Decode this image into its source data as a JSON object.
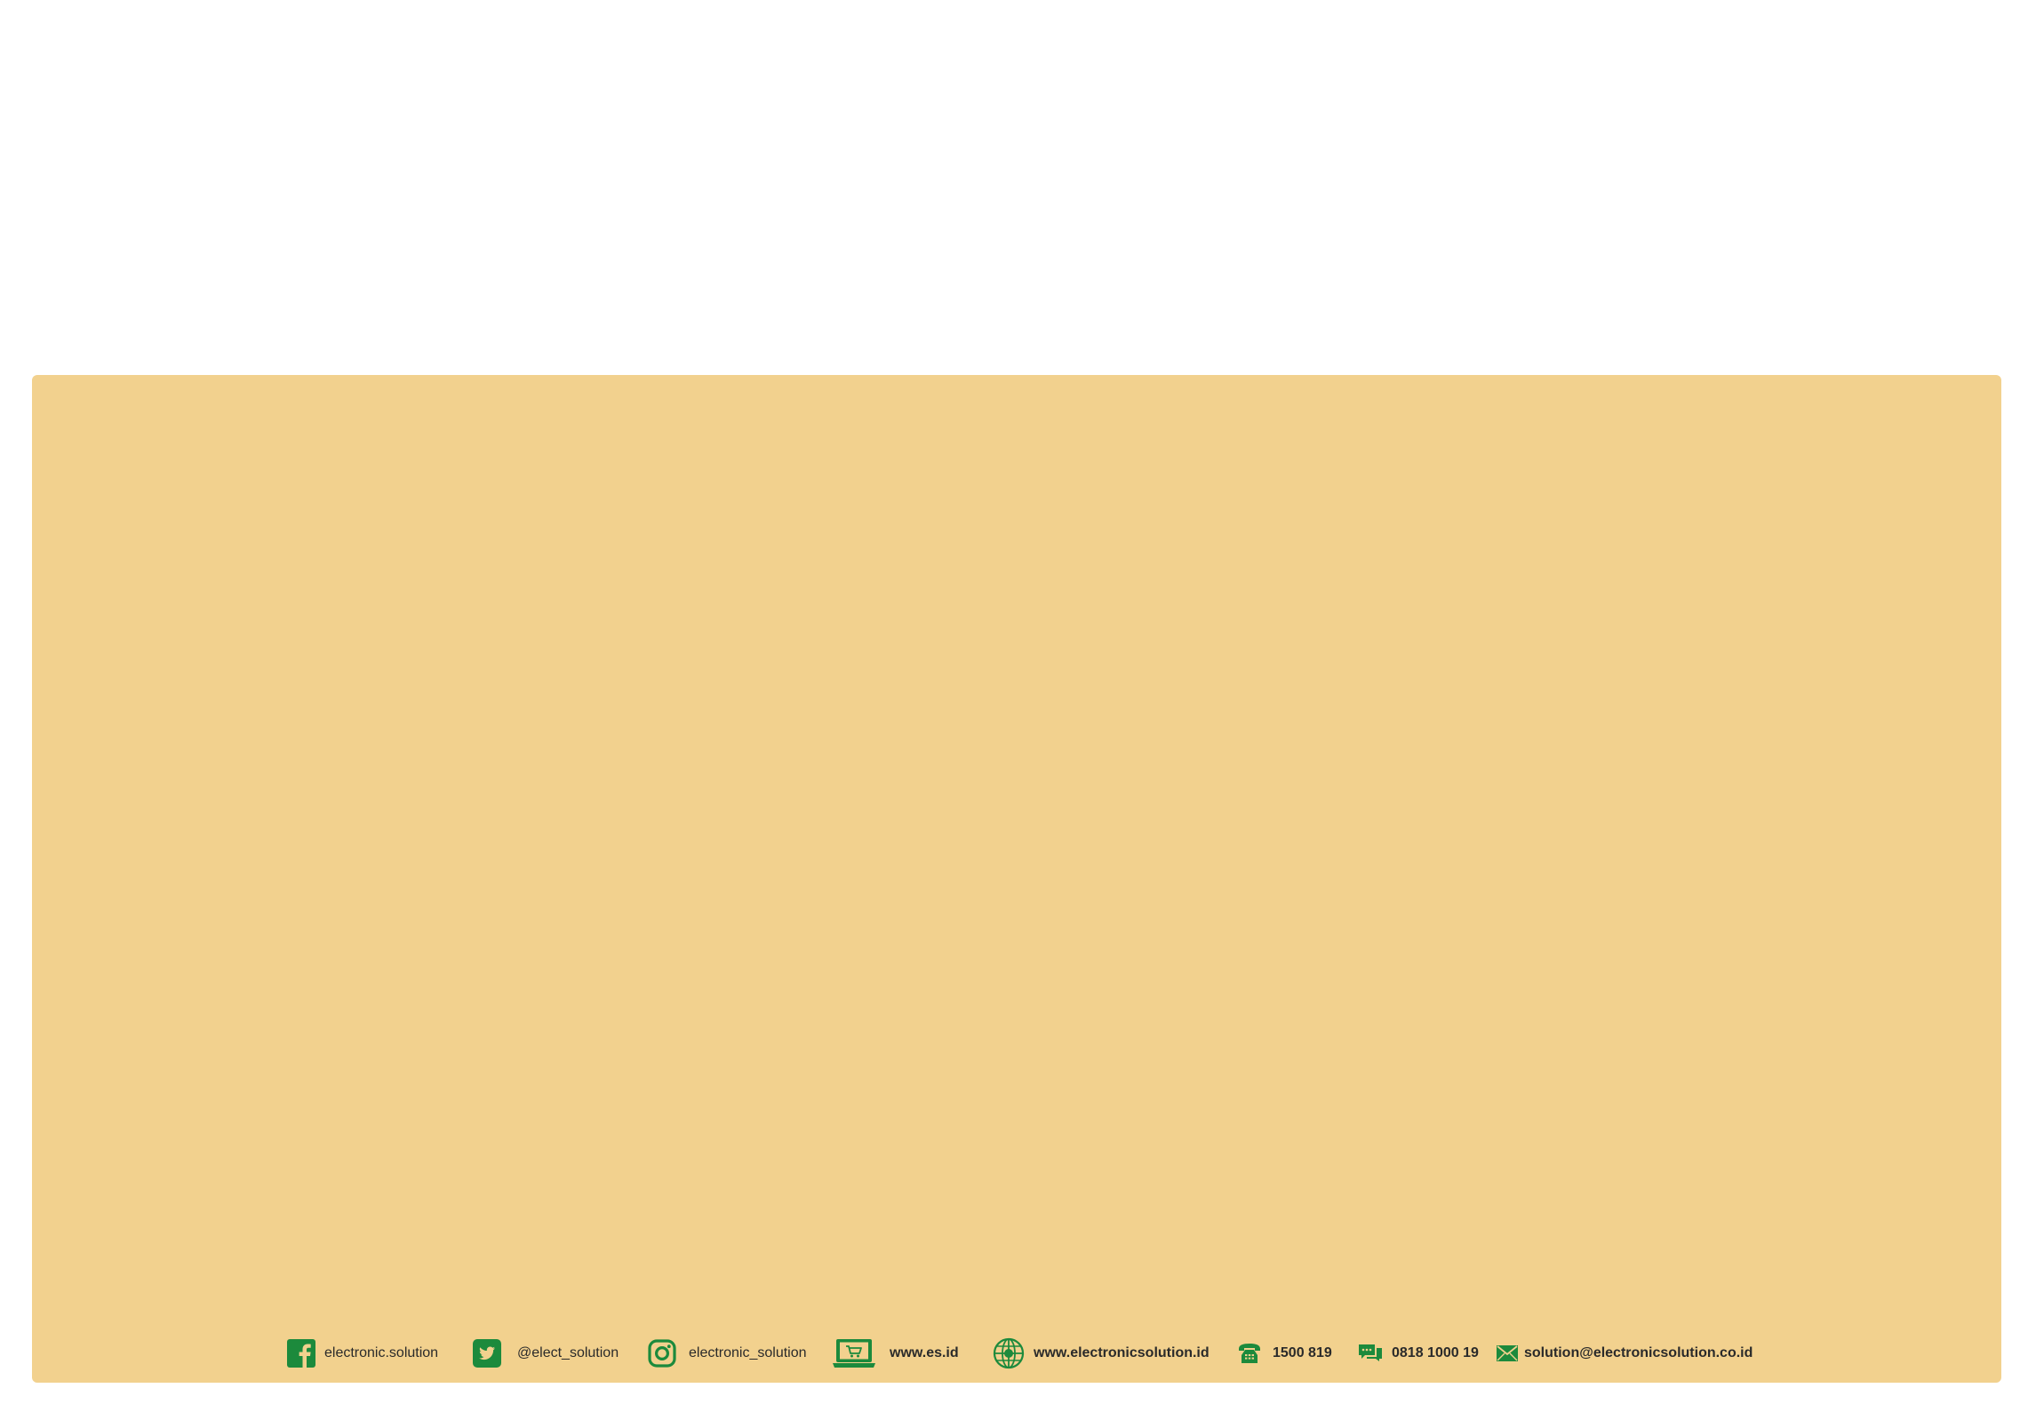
{
  "colors": {
    "panel_background": "#f2d18e",
    "icon_green": "#1c8a3c",
    "text": "#2a2a2a"
  },
  "footer": {
    "items": [
      {
        "icon": "facebook-icon",
        "label": "electronic.solution"
      },
      {
        "icon": "twitter-icon",
        "label": "@elect_solution"
      },
      {
        "icon": "instagram-icon",
        "label": "electronic_solution"
      },
      {
        "icon": "laptop-cart-icon",
        "label": "www.es.id"
      },
      {
        "icon": "globe-icon",
        "label": "www.electronicsolution.id"
      },
      {
        "icon": "phone-icon",
        "label": "1500 819"
      },
      {
        "icon": "chat-icon",
        "label": "0818 1000 19"
      },
      {
        "icon": "mail-icon",
        "label": "solution@electronicsolution.co.id"
      }
    ]
  }
}
